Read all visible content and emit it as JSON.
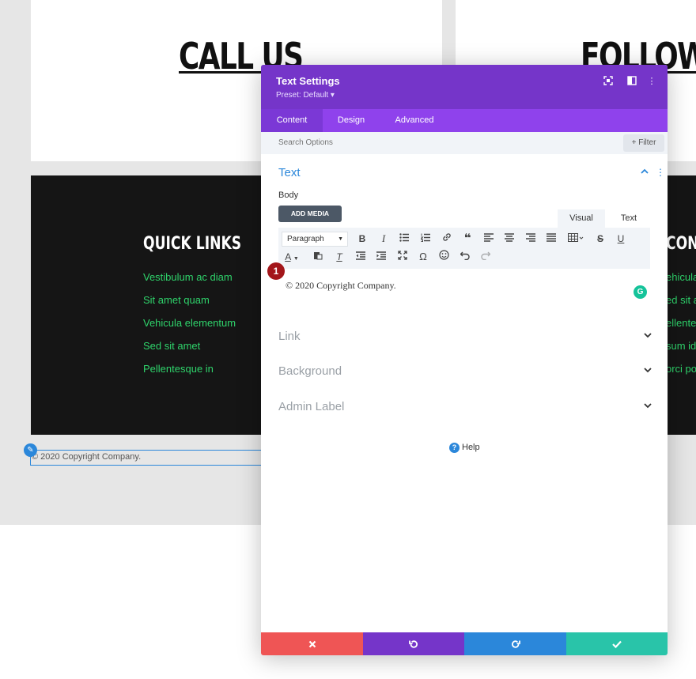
{
  "background": {
    "headings": {
      "call": "CALL US",
      "follow": "FOLLOW"
    },
    "quick_links": {
      "title": "QUICK LINKS",
      "items": [
        "Vestibulum ac diam",
        "Sit amet quam",
        "Vehicula elementum",
        "Sed sit amet",
        "Pellentesque in"
      ]
    },
    "right_column": {
      "title": "CONTA",
      "items": [
        "ehicula",
        "ed sit a",
        "ellente",
        "sum id",
        "orci po"
      ]
    },
    "footer_text": "© 2020 Copyright Company."
  },
  "modal": {
    "title": "Text Settings",
    "preset": "Preset: Default ▾",
    "tabs": {
      "content": "Content",
      "design": "Design",
      "advanced": "Advanced"
    },
    "search_placeholder": "Search Options",
    "filter_label": "+ Filter",
    "text_section": {
      "title": "Text",
      "body_label": "Body",
      "add_media": "ADD MEDIA",
      "visual_tab": "Visual",
      "text_tab": "Text",
      "paragraph_select": "Paragraph",
      "content": "© 2020 Copyright Company."
    },
    "badge": "1",
    "sections": {
      "link": "Link",
      "background": "Background",
      "admin_label": "Admin Label"
    },
    "help": "Help",
    "colors": {
      "header": "#7535c9",
      "tabs": "#8f42ec",
      "accent": "#2b87da",
      "cancel": "#ef5555",
      "save": "#29c4a9"
    }
  }
}
